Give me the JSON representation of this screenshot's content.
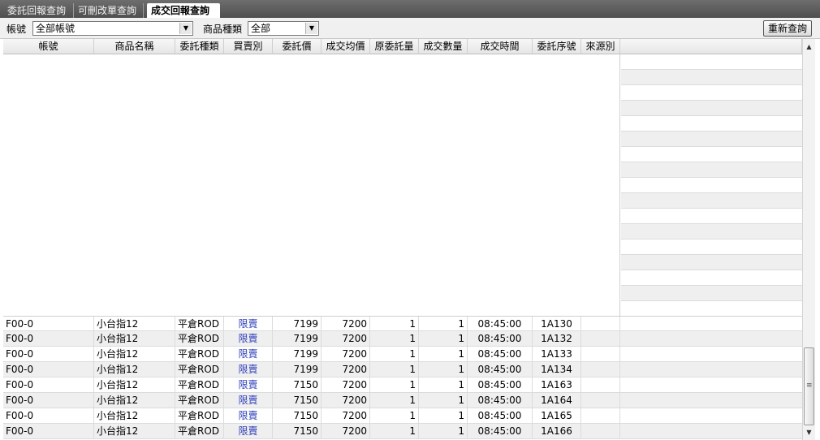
{
  "tabs": [
    {
      "label": "委託回報查詢",
      "active": false
    },
    {
      "label": "可刪改單查詢",
      "active": false
    },
    {
      "label": "成交回報查詢",
      "active": true
    }
  ],
  "filters": {
    "account_label": "帳號",
    "account_value": "全部帳號",
    "product_type_label": "商品種類",
    "product_type_value": "全部",
    "requery_button": "重新查詢"
  },
  "table": {
    "columns": [
      "帳號",
      "商品名稱",
      "委託種類",
      "買賣別",
      "委託價",
      "成交均價",
      "原委託量",
      "成交數量",
      "成交時間",
      "委託序號",
      "來源別"
    ],
    "rows": [
      [
        "F00-0",
        "小台指12",
        "平倉ROD",
        "限賣",
        "7199",
        "7200",
        "1",
        "1",
        "08:45:00",
        "1A130",
        ""
      ],
      [
        "F00-0",
        "小台指12",
        "平倉ROD",
        "限賣",
        "7199",
        "7200",
        "1",
        "1",
        "08:45:00",
        "1A132",
        ""
      ],
      [
        "F00-0",
        "小台指12",
        "平倉ROD",
        "限賣",
        "7199",
        "7200",
        "1",
        "1",
        "08:45:00",
        "1A133",
        ""
      ],
      [
        "F00-0",
        "小台指12",
        "平倉ROD",
        "限賣",
        "7199",
        "7200",
        "1",
        "1",
        "08:45:00",
        "1A134",
        ""
      ],
      [
        "F00-0",
        "小台指12",
        "平倉ROD",
        "限賣",
        "7150",
        "7200",
        "1",
        "1",
        "08:45:00",
        "1A163",
        ""
      ],
      [
        "F00-0",
        "小台指12",
        "平倉ROD",
        "限賣",
        "7150",
        "7200",
        "1",
        "1",
        "08:45:00",
        "1A164",
        ""
      ],
      [
        "F00-0",
        "小台指12",
        "平倉ROD",
        "限賣",
        "7150",
        "7200",
        "1",
        "1",
        "08:45:00",
        "1A165",
        ""
      ],
      [
        "F00-0",
        "小台指12",
        "平倉ROD",
        "限賣",
        "7150",
        "7200",
        "1",
        "1",
        "08:45:00",
        "1A166",
        ""
      ]
    ]
  },
  "colors": {
    "side_sell": "#2b3bb8",
    "tab_bar": "#5a5a5a",
    "row_alt": "#efefef"
  },
  "icons": {
    "dropdown": "chevron-down-icon",
    "scroll_up": "scroll-up-arrow-icon",
    "scroll_down": "scroll-down-arrow-icon"
  }
}
